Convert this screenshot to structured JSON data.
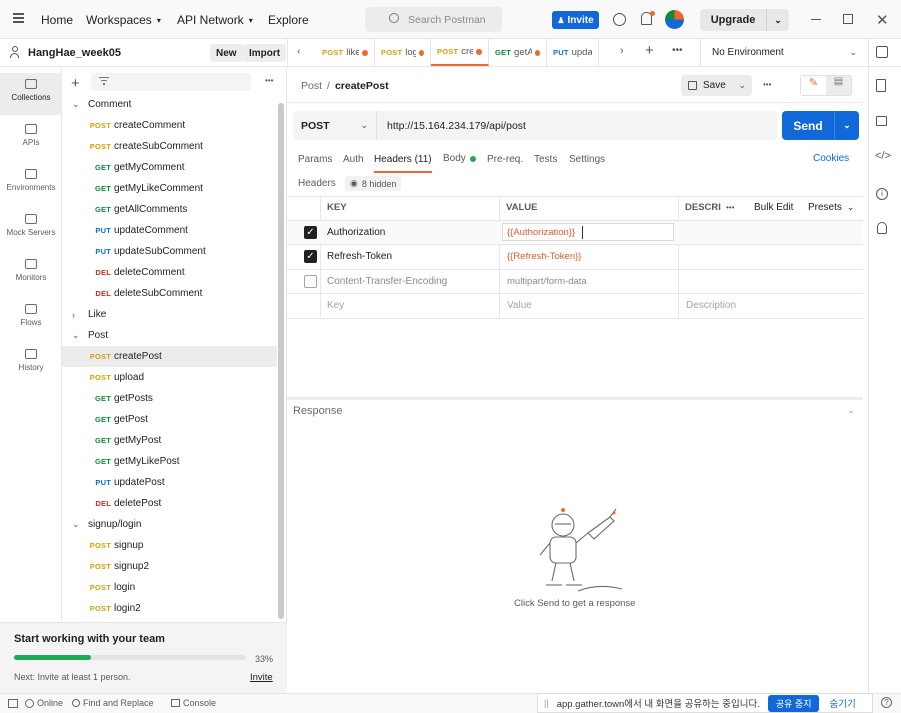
{
  "topbar": {
    "home": "Home",
    "workspaces": "Workspaces",
    "api_network": "API Network",
    "explore": "Explore",
    "search_placeholder": "Search Postman",
    "invite": "Invite",
    "upgrade": "Upgrade"
  },
  "workspace": {
    "name": "HangHae_week05",
    "new": "New",
    "import": "Import"
  },
  "tabs": [
    {
      "method": "POST",
      "name": "like"
    },
    {
      "method": "POST",
      "name": "log"
    },
    {
      "method": "POST",
      "name": "cre"
    },
    {
      "method": "GET",
      "name": "getA"
    },
    {
      "method": "PUT",
      "name": "updat"
    }
  ],
  "environment": "No Environment",
  "rail": [
    {
      "label": "Collections",
      "icon": "collections-icon"
    },
    {
      "label": "APIs",
      "icon": "apis-icon"
    },
    {
      "label": "Environments",
      "icon": "environments-icon"
    },
    {
      "label": "Mock Servers",
      "icon": "mock-servers-icon"
    },
    {
      "label": "Monitors",
      "icon": "monitors-icon"
    },
    {
      "label": "Flows",
      "icon": "flows-icon"
    },
    {
      "label": "History",
      "icon": "history-icon"
    }
  ],
  "tree": {
    "comment": {
      "label": "Comment",
      "items": [
        {
          "method": "POST",
          "name": "createComment"
        },
        {
          "method": "POST",
          "name": "createSubComment"
        },
        {
          "method": "GET",
          "name": "getMyComment"
        },
        {
          "method": "GET",
          "name": "getMyLikeComment"
        },
        {
          "method": "GET",
          "name": "getAllComments"
        },
        {
          "method": "PUT",
          "name": "updateComment"
        },
        {
          "method": "PUT",
          "name": "updateSubComment"
        },
        {
          "method": "DEL",
          "name": "deleteComment"
        },
        {
          "method": "DEL",
          "name": "deleteSubComment"
        }
      ]
    },
    "like": {
      "label": "Like"
    },
    "post": {
      "label": "Post",
      "items": [
        {
          "method": "POST",
          "name": "createPost"
        },
        {
          "method": "POST",
          "name": "upload"
        },
        {
          "method": "GET",
          "name": "getPosts"
        },
        {
          "method": "GET",
          "name": "getPost"
        },
        {
          "method": "GET",
          "name": "getMyPost"
        },
        {
          "method": "GET",
          "name": "getMyLikePost"
        },
        {
          "method": "PUT",
          "name": "updatePost"
        },
        {
          "method": "DEL",
          "name": "deletePost"
        }
      ]
    },
    "signup": {
      "label": "signup/login",
      "items": [
        {
          "method": "POST",
          "name": "signup"
        },
        {
          "method": "POST",
          "name": "signup2"
        },
        {
          "method": "POST",
          "name": "login"
        },
        {
          "method": "POST",
          "name": "login2"
        }
      ]
    }
  },
  "team": {
    "title": "Start working with your team",
    "percent_label": "33%",
    "progress": 0.33,
    "next": "Next: Invite at least 1 person.",
    "invite": "Invite"
  },
  "request": {
    "breadcrumb_parent": "Post",
    "breadcrumb_sep": "/",
    "breadcrumb_name": "createPost",
    "save": "Save",
    "method": "POST",
    "url": "http://15.164.234.179/api/post",
    "send": "Send"
  },
  "subtabs": {
    "params": "Params",
    "auth": "Auth",
    "headers": "Headers (11)",
    "body": "Body",
    "prereq": "Pre-req.",
    "tests": "Tests",
    "settings": "Settings",
    "cookies": "Cookies"
  },
  "headers_bar": {
    "label": "Headers",
    "hidden": "8 hidden"
  },
  "table": {
    "col_key": "KEY",
    "col_value": "VALUE",
    "col_desc": "DESCRI",
    "bulk_edit": "Bulk Edit",
    "presets": "Presets",
    "rows": [
      {
        "key": "Authorization",
        "value": "{{Authorization}}",
        "checked": true
      },
      {
        "key": "Refresh-Token",
        "value": "{{Refresh-Token}}",
        "checked": true
      },
      {
        "key": "Content-Transfer-Encoding",
        "value": "multipart/form-data",
        "checked": false
      }
    ],
    "placeholder_key": "Key",
    "placeholder_value": "Value",
    "placeholder_desc": "Description"
  },
  "response": {
    "label": "Response",
    "empty": "Click Send to get a response"
  },
  "statusbar": {
    "online": "Online",
    "find": "Find and Replace",
    "console": "Console"
  },
  "share": {
    "text": "app.gather.town에서 내 화면을 공유하는 중입니다.",
    "stop": "공유 중지",
    "hide": "숨기기"
  }
}
